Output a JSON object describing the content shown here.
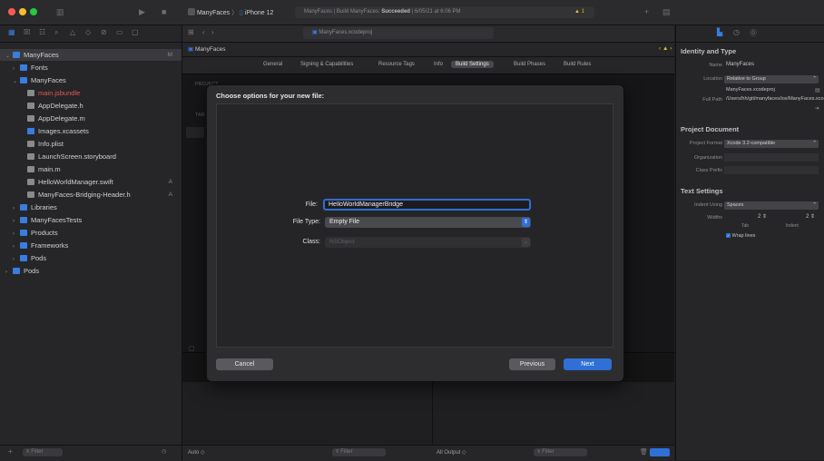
{
  "colors": {
    "accent": "#2f6fd6",
    "warning": "#e8b93a",
    "red_close": "#ff5f57",
    "yellow_min": "#febc2e",
    "green_max": "#28c840"
  },
  "toolbar": {
    "scheme_project": "ManyFaces",
    "scheme_device": "iPhone 12",
    "status_prefix": "ManyFaces | Build ManyFaces: ",
    "status_result": "Succeeded",
    "status_time": " | 6/05/21 at 6:06 PM",
    "warning_count": "1"
  },
  "navigator": {
    "items": [
      {
        "label": "ManyFaces",
        "level": 0,
        "icon": "project-icon",
        "disclosure": "open",
        "badge": "M",
        "selected": true
      },
      {
        "label": "Fonts",
        "level": 1,
        "icon": "folder-icon",
        "disclosure": "closed"
      },
      {
        "label": "ManyFaces",
        "level": 1,
        "icon": "folder-icon",
        "disclosure": "open"
      },
      {
        "label": "main.jsbundle",
        "level": 2,
        "icon": "file-icon",
        "red": true
      },
      {
        "label": "AppDelegate.h",
        "level": 2,
        "icon": "header-file-icon"
      },
      {
        "label": "AppDelegate.m",
        "level": 2,
        "icon": "objc-file-icon"
      },
      {
        "label": "Images.xcassets",
        "level": 2,
        "icon": "assets-icon"
      },
      {
        "label": "Info.plist",
        "level": 2,
        "icon": "plist-icon"
      },
      {
        "label": "LaunchScreen.storyboard",
        "level": 2,
        "icon": "storyboard-icon"
      },
      {
        "label": "main.m",
        "level": 2,
        "icon": "objc-file-icon"
      },
      {
        "label": "HelloWorldManager.swift",
        "level": 2,
        "icon": "swift-file-icon",
        "badge": "A"
      },
      {
        "label": "ManyFaces-Bridging-Header.h",
        "level": 2,
        "icon": "header-file-icon",
        "badge": "A"
      },
      {
        "label": "Libraries",
        "level": 1,
        "icon": "folder-icon",
        "disclosure": "closed"
      },
      {
        "label": "ManyFacesTests",
        "level": 1,
        "icon": "folder-icon",
        "disclosure": "closed"
      },
      {
        "label": "Products",
        "level": 1,
        "icon": "folder-icon",
        "disclosure": "closed"
      },
      {
        "label": "Frameworks",
        "level": 1,
        "icon": "folder-icon",
        "disclosure": "closed"
      },
      {
        "label": "Pods",
        "level": 1,
        "icon": "folder-icon",
        "disclosure": "closed"
      },
      {
        "label": "Pods",
        "level": 0,
        "icon": "project-icon",
        "disclosure": "closed"
      }
    ],
    "filter_placeholder": "Filter"
  },
  "editor": {
    "tab_label": "ManyFaces.xcodeproj",
    "jump_project": "ManyFaces",
    "settings_tabs": [
      "General",
      "Signing & Capabilities",
      "Resource Tags",
      "Info",
      "Build Settings",
      "Build Phases",
      "Build Rules"
    ],
    "active_tab": "Build Settings",
    "project_section": "PROJECT",
    "targets_section": "TAR",
    "debug_scheme": "Auto",
    "filter_placeholder": "Filter",
    "output_label": "All Output"
  },
  "inspector": {
    "identity_header": "Identity and Type",
    "name_label": "Name",
    "name_value": "ManyFaces",
    "location_label": "Location",
    "location_value": "Relative to Group",
    "location_file": "ManyFaces.xcodeproj",
    "fullpath_label": "Full Path",
    "fullpath_value": "/Users/hh/git/manyfaces/ios/ManyFaces.xcodeproj",
    "project_doc_header": "Project Document",
    "format_label": "Project Format",
    "format_value": "Xcode 3.2-compatible",
    "org_label": "Organization",
    "prefix_label": "Class Prefix",
    "text_settings_header": "Text Settings",
    "indent_using_label": "Indent Using",
    "indent_using_value": "Spaces",
    "widths_label": "Widths",
    "tab_width": "2",
    "indent_width": "2",
    "tab_caption": "Tab",
    "indent_caption": "Indent",
    "wrap_lines_label": "Wrap lines"
  },
  "sheet": {
    "title": "Choose options for your new file:",
    "file_label": "File:",
    "file_value": "HelloWorldManagerBridge",
    "filetype_label": "File Type:",
    "filetype_value": "Empty File",
    "class_label": "Class:",
    "class_value": "NSObject",
    "cancel_label": "Cancel",
    "previous_label": "Previous",
    "next_label": "Next"
  }
}
